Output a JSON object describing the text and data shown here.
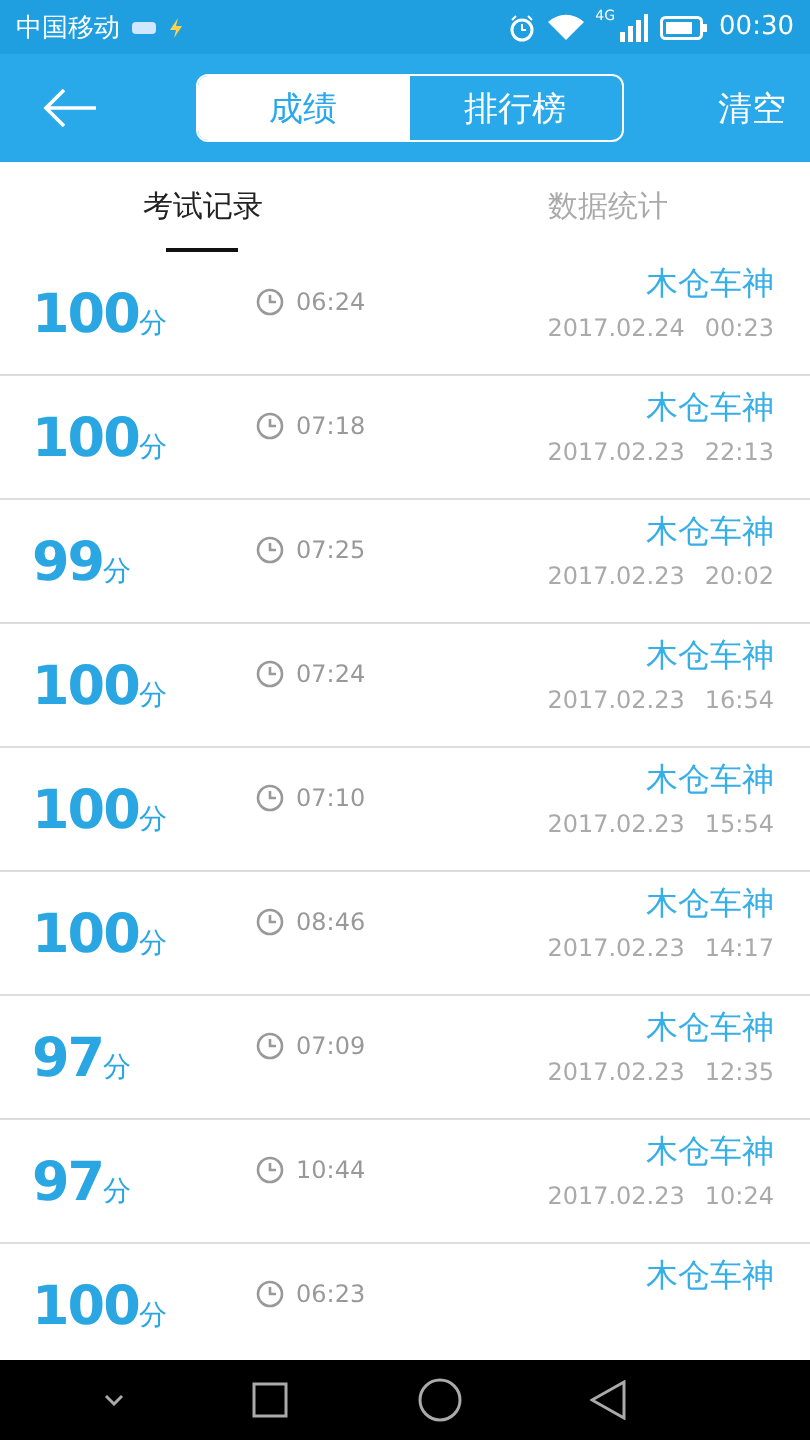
{
  "status_bar": {
    "carrier": "中国移动",
    "network": "4G",
    "time": "00:30"
  },
  "header": {
    "segments": [
      {
        "label": "成绩",
        "selected": true
      },
      {
        "label": "排行榜",
        "selected": false
      }
    ],
    "action": "清空"
  },
  "tabs": [
    {
      "label": "考试记录",
      "selected": true
    },
    {
      "label": "数据统计",
      "selected": false
    }
  ],
  "records": [
    {
      "score": "100",
      "unit": "分",
      "duration": "06:24",
      "name": "木仓车神",
      "date": "2017.02.24",
      "time": "00:23"
    },
    {
      "score": "100",
      "unit": "分",
      "duration": "07:18",
      "name": "木仓车神",
      "date": "2017.02.23",
      "time": "22:13"
    },
    {
      "score": "99",
      "unit": "分",
      "duration": "07:25",
      "name": "木仓车神",
      "date": "2017.02.23",
      "time": "20:02"
    },
    {
      "score": "100",
      "unit": "分",
      "duration": "07:24",
      "name": "木仓车神",
      "date": "2017.02.23",
      "time": "16:54"
    },
    {
      "score": "100",
      "unit": "分",
      "duration": "07:10",
      "name": "木仓车神",
      "date": "2017.02.23",
      "time": "15:54"
    },
    {
      "score": "100",
      "unit": "分",
      "duration": "08:46",
      "name": "木仓车神",
      "date": "2017.02.23",
      "time": "14:17"
    },
    {
      "score": "97",
      "unit": "分",
      "duration": "07:09",
      "name": "木仓车神",
      "date": "2017.02.23",
      "time": "12:35"
    },
    {
      "score": "97",
      "unit": "分",
      "duration": "10:44",
      "name": "木仓车神",
      "date": "2017.02.23",
      "time": "10:24"
    },
    {
      "score": "100",
      "unit": "分",
      "duration": "06:23",
      "name": "木仓车神"
    }
  ]
}
